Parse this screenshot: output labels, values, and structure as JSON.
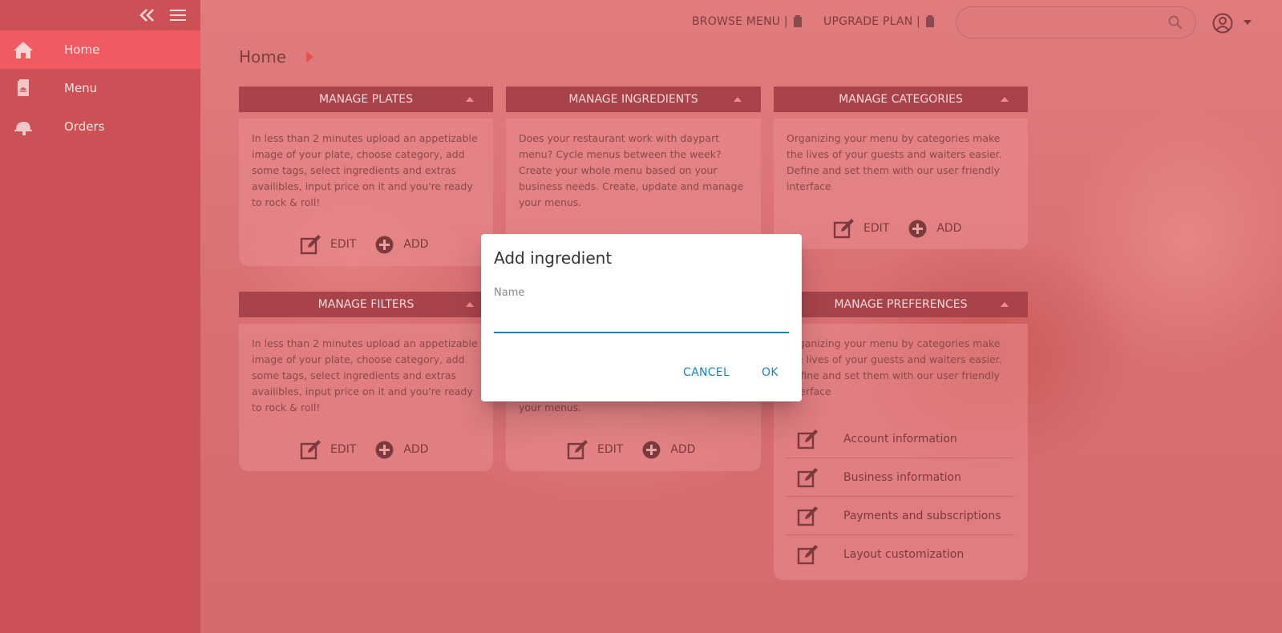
{
  "sidebar": {
    "items": [
      {
        "label": "Home",
        "icon": "home-icon",
        "active": true
      },
      {
        "label": "Menu",
        "icon": "menu-book-icon",
        "active": false
      },
      {
        "label": "Orders",
        "icon": "cloche-icon",
        "active": false
      }
    ]
  },
  "topbar": {
    "browse_menu": "BROWSE MENU |",
    "upgrade_plan": "UPGRADE PLAN |",
    "search_placeholder": ""
  },
  "page": {
    "title": "Home"
  },
  "cards": {
    "plates": {
      "title": "MANAGE PLATES",
      "text": "In less than 2 minutes upload an appetizable image of your plate, choose category, add some tags, select ingredients and extras availibles, input price on it and you're ready to rock & roll!",
      "edit": "EDIT",
      "add": "ADD"
    },
    "ingredients": {
      "title": "MANAGE INGREDIENTS",
      "text": "Does your restaurant work with daypart menu? Cycle menus between the week? Create your whole menu based on your business needs. Create, update and manage your menus."
    },
    "categories": {
      "title": "MANAGE CATEGORIES",
      "text": "Organizing your menu by categories make the lives of your guests and waiters easier. Define and set them with our user friendly interface",
      "edit": "EDIT",
      "add": "ADD"
    },
    "filters": {
      "title": "MANAGE FILTERS",
      "text": "In less than 2 minutes upload an appetizable image of your plate, choose category, add some tags, select ingredients and extras availibles, input price on it and you're ready to rock & roll!",
      "edit": "EDIT",
      "add": "ADD"
    },
    "second_ingredients": {
      "text_tail": "your menus.",
      "edit": "EDIT",
      "add": "ADD"
    },
    "preferences": {
      "title": "MANAGE PREFERENCES",
      "text": "Organizing your menu by categories make the lives of your guests and waiters easier. Define and set them with our user friendly interface",
      "items": [
        "Account information",
        "Business information",
        "Payments and subscriptions",
        "Layout customization"
      ]
    }
  },
  "dialog": {
    "title": "Add ingredient",
    "field_label": "Name",
    "field_value": "",
    "cancel": "CANCEL",
    "ok": "OK"
  },
  "colors": {
    "sidebar": "#cc5157",
    "sidebar_active": "#f05a60",
    "card_header": "#a8434c",
    "dialog_accent": "#1f7fb4"
  }
}
